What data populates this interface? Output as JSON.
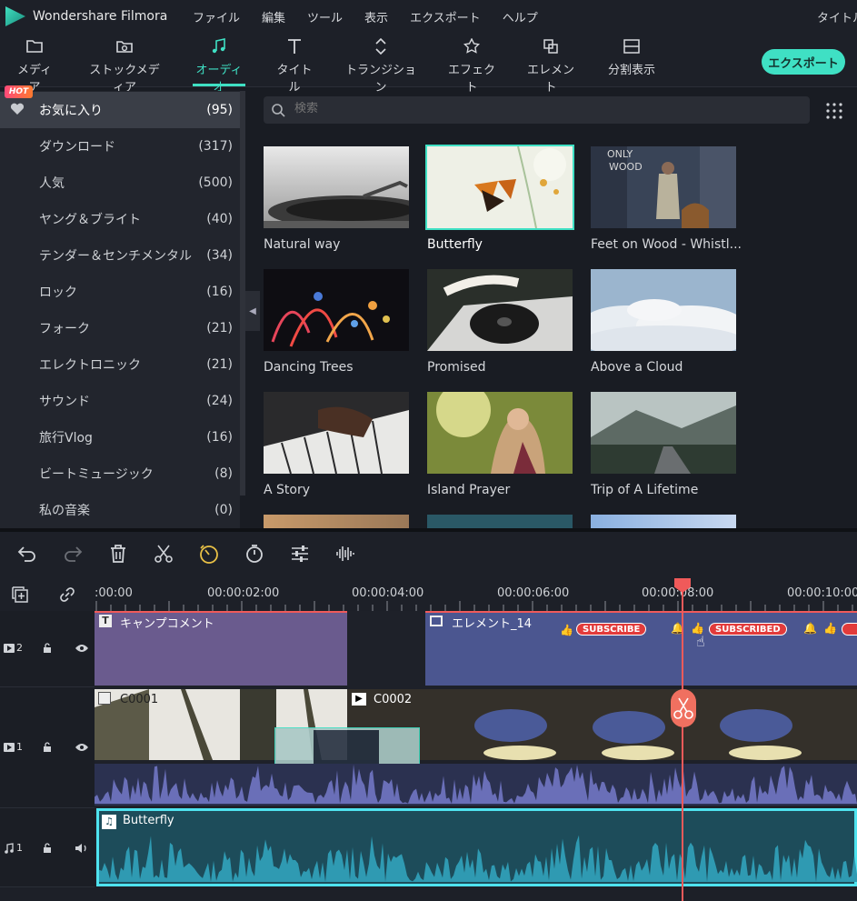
{
  "titlebar": {
    "app_name": "Wondershare Filmora",
    "menus": [
      "ファイル",
      "編集",
      "ツール",
      "表示",
      "エクスポート",
      "ヘルプ"
    ],
    "right_text": "タイトル"
  },
  "toolbar": {
    "tabs": [
      {
        "label": "メディア",
        "icon": "folder-icon"
      },
      {
        "label": "ストックメディア",
        "icon": "stock-media-icon"
      },
      {
        "label": "オーディオ",
        "icon": "music-note-icon"
      },
      {
        "label": "タイトル",
        "icon": "text-icon"
      },
      {
        "label": "トランジション",
        "icon": "transition-icon"
      },
      {
        "label": "エフェクト",
        "icon": "effect-icon"
      },
      {
        "label": "エレメント",
        "icon": "element-icon"
      },
      {
        "label": "分割表示",
        "icon": "split-screen-icon"
      }
    ],
    "active_tab": "オーディオ",
    "export_label": "エクスポート",
    "accent": "#3fe0c4"
  },
  "sidebar": {
    "hot_badge": "HOT",
    "items": [
      {
        "label": "お気に入り",
        "count": "(95)"
      },
      {
        "label": "ダウンロード",
        "count": "(317)"
      },
      {
        "label": "人気",
        "count": "(500)"
      },
      {
        "label": "ヤング＆ブライト",
        "count": "(40)"
      },
      {
        "label": "テンダー＆センチメンタル",
        "count": "(34)"
      },
      {
        "label": "ロック",
        "count": "(16)"
      },
      {
        "label": "フォーク",
        "count": "(21)"
      },
      {
        "label": "エレクトロニック",
        "count": "(21)"
      },
      {
        "label": "サウンド",
        "count": "(24)"
      },
      {
        "label": "旅行Vlog",
        "count": "(16)"
      },
      {
        "label": "ビートミュージック",
        "count": "(8)"
      },
      {
        "label": "私の音楽",
        "count": "(0)"
      }
    ]
  },
  "search": {
    "placeholder": "検索"
  },
  "media": {
    "items": [
      {
        "name": "Natural way"
      },
      {
        "name": "Butterfly"
      },
      {
        "name": "Feet on Wood - Whistl..."
      },
      {
        "name": "Dancing Trees"
      },
      {
        "name": "Promised"
      },
      {
        "name": "Above a Cloud"
      },
      {
        "name": "A Story"
      },
      {
        "name": "Island Prayer"
      },
      {
        "name": "Trip of A Lifetime"
      }
    ],
    "selected": "Butterfly",
    "thumb_text": "ONLY WOOD"
  },
  "timeline": {
    "ruler": [
      ":00:00",
      "00:00:02:00",
      "00:00:04:00",
      "00:00:06:00",
      "00:00:08:00",
      "00:00:10:00"
    ],
    "tracks": {
      "v2": {
        "label": "2",
        "clips": [
          "キャンプコメント",
          "エレメント_14"
        ]
      },
      "v1": {
        "label": "1",
        "clips": [
          "C0001",
          "C0002"
        ]
      },
      "a1": {
        "label": "1",
        "clips": [
          "Butterfly"
        ]
      }
    },
    "stickers": [
      "SUBSCRIBE",
      "SUBSCRIBED"
    ]
  }
}
